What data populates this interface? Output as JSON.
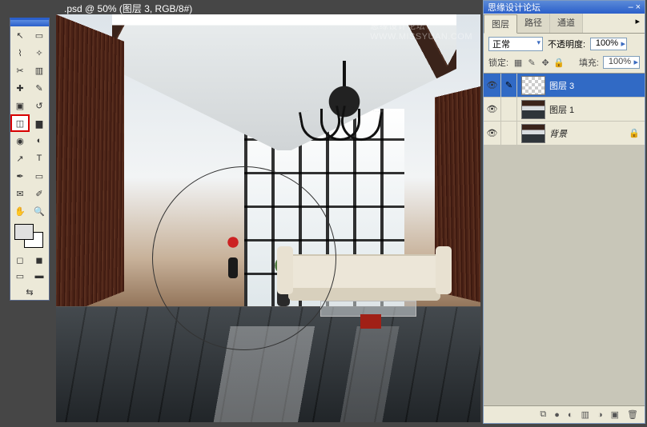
{
  "window": {
    "title": ".psd @ 50% (图层 3, RGB/8#)"
  },
  "watermark": {
    "text1": "思缘设计论坛",
    "text2": "WWW.MISSYUAN.COM"
  },
  "toolbox": {
    "tools": [
      {
        "name": "move-tool",
        "glyph": "↖"
      },
      {
        "name": "marquee-tool",
        "glyph": "▭"
      },
      {
        "name": "lasso-tool",
        "glyph": "⌇"
      },
      {
        "name": "magic-wand-tool",
        "glyph": "✧"
      },
      {
        "name": "crop-tool",
        "glyph": "✂"
      },
      {
        "name": "slice-tool",
        "glyph": "▥"
      },
      {
        "name": "healing-brush-tool",
        "glyph": "✚"
      },
      {
        "name": "brush-tool",
        "glyph": "✎"
      },
      {
        "name": "clone-stamp-tool",
        "glyph": "▣"
      },
      {
        "name": "history-brush-tool",
        "glyph": "↺"
      },
      {
        "name": "eraser-tool",
        "glyph": "◫",
        "selected": true
      },
      {
        "name": "gradient-tool",
        "glyph": "▆"
      },
      {
        "name": "blur-tool",
        "glyph": "◉"
      },
      {
        "name": "dodge-tool",
        "glyph": "◐"
      },
      {
        "name": "path-select-tool",
        "glyph": "↗"
      },
      {
        "name": "type-tool",
        "glyph": "T"
      },
      {
        "name": "pen-tool",
        "glyph": "✒"
      },
      {
        "name": "shape-tool",
        "glyph": "▭"
      },
      {
        "name": "notes-tool",
        "glyph": "✉"
      },
      {
        "name": "eyedropper-tool",
        "glyph": "✐"
      },
      {
        "name": "hand-tool",
        "glyph": "✋"
      },
      {
        "name": "zoom-tool",
        "glyph": "🔍"
      }
    ],
    "foreground_color": "#e0e0e0",
    "background_color": "#ffffff"
  },
  "layers_panel": {
    "title": "思缘设计论坛",
    "tabs": [
      {
        "label": "图层",
        "active": true
      },
      {
        "label": "路径",
        "active": false
      },
      {
        "label": "通道",
        "active": false
      }
    ],
    "blend_mode": "正常",
    "opacity_label": "不透明度:",
    "opacity_value": "100%",
    "lock_label": "锁定:",
    "fill_label": "填充:",
    "fill_value": "100%",
    "layers": [
      {
        "name": "图层 3",
        "visible": true,
        "selected": true,
        "thumb": "checker"
      },
      {
        "name": "图层 1",
        "visible": true,
        "selected": false,
        "thumb": "photo"
      },
      {
        "name": "背景",
        "visible": true,
        "selected": false,
        "thumb": "photo",
        "locked": true,
        "bg": true
      }
    ],
    "footer_icons": [
      {
        "name": "link-layers-icon",
        "glyph": "⧉"
      },
      {
        "name": "layer-style-icon",
        "glyph": "●"
      },
      {
        "name": "layer-mask-icon",
        "glyph": "◐"
      },
      {
        "name": "new-group-icon",
        "glyph": "▥"
      },
      {
        "name": "adjustment-layer-icon",
        "glyph": "◑"
      },
      {
        "name": "new-layer-icon",
        "glyph": "▣"
      },
      {
        "name": "delete-layer-icon",
        "glyph": "🗑"
      }
    ]
  }
}
